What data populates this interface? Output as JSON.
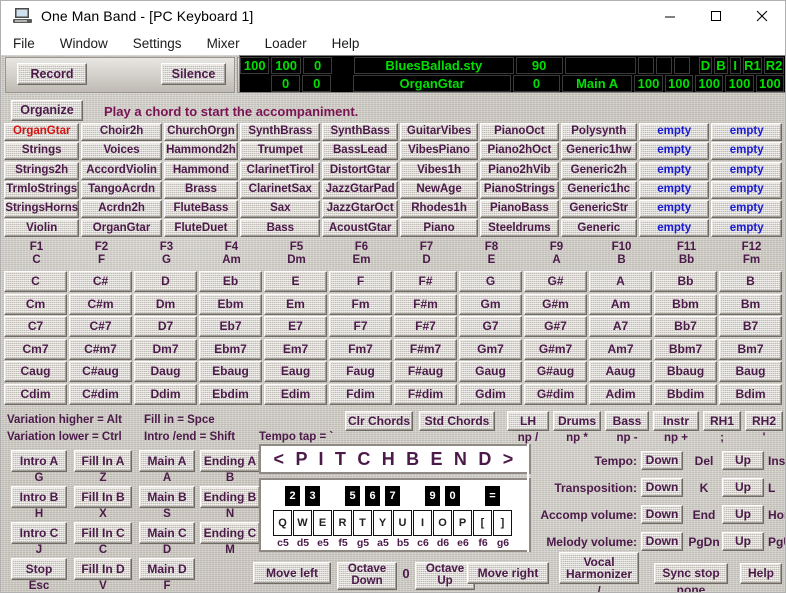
{
  "window": {
    "title": "One Man Band - [PC Keyboard 1]",
    "icon": "computer-icon",
    "minimize": "minimize-icon",
    "maximize": "maximize-icon",
    "close": "close-icon"
  },
  "menu": [
    "File",
    "Window",
    "Settings",
    "Mixer",
    "Loader",
    "Help"
  ],
  "toolbar": {
    "record": "Record",
    "silence": "Silence",
    "organize": "Organize",
    "status_message": "Play a chord to start the accompaniment."
  },
  "led": {
    "color": "#00e000",
    "row1": [
      "100",
      "100",
      "0",
      "",
      "BluesBallad.sty",
      "90",
      "",
      "",
      "",
      "",
      "",
      "D",
      "B",
      "I",
      "R1",
      "R2"
    ],
    "row2": [
      "",
      "0",
      "0",
      "",
      "OrganGtar",
      "0",
      "Main A",
      "100",
      "100",
      "100",
      "100",
      "100"
    ]
  },
  "instruments": {
    "selected": "OrganGtar",
    "rows": [
      [
        "OrganGtar",
        "Choir2h",
        "ChurchOrgn",
        "SynthBrass",
        "SynthBass",
        "GuitarVibes",
        "PianoOct",
        "Polysynth",
        "empty",
        "empty"
      ],
      [
        "Strings",
        "Voices",
        "Hammond2h",
        "Trumpet",
        "BassLead",
        "VibesPiano",
        "Piano2hOct",
        "Generic1hw",
        "empty",
        "empty"
      ],
      [
        "Strings2h",
        "AccordViolin",
        "Hammond",
        "ClarinetTirol",
        "DistortGtar",
        "Vibes1h",
        "Piano2hVib",
        "Generic2h",
        "empty",
        "empty"
      ],
      [
        "TrmloStrings",
        "TangoAcrdn",
        "Brass",
        "ClarinetSax",
        "JazzGtarPad",
        "NewAge",
        "PianoStrings",
        "Generic1hc",
        "empty",
        "empty"
      ],
      [
        "StringsHorns",
        "Acrdn2h",
        "FluteBass",
        "Sax",
        "JazzGtarOct",
        "Rhodes1h",
        "PianoBass",
        "GenericStr",
        "empty",
        "empty"
      ],
      [
        "Violin",
        "OrganGtar",
        "FluteDuet",
        "Bass",
        "AcoustGtar",
        "Piano",
        "Steeldrums",
        "Generic",
        "empty",
        "empty"
      ]
    ]
  },
  "fkeys": [
    {
      "fn": "F1",
      "chord": "C"
    },
    {
      "fn": "F2",
      "chord": "F"
    },
    {
      "fn": "F3",
      "chord": "G"
    },
    {
      "fn": "F4",
      "chord": "Am"
    },
    {
      "fn": "F5",
      "chord": "Dm"
    },
    {
      "fn": "F6",
      "chord": "Em"
    },
    {
      "fn": "F7",
      "chord": "D"
    },
    {
      "fn": "F8",
      "chord": "E"
    },
    {
      "fn": "F9",
      "chord": "A"
    },
    {
      "fn": "F10",
      "chord": "B"
    },
    {
      "fn": "F11",
      "chord": "Bb"
    },
    {
      "fn": "F12",
      "chord": "Fm"
    }
  ],
  "chords": {
    "rows": [
      [
        "C",
        "C#",
        "D",
        "Eb",
        "E",
        "F",
        "F#",
        "G",
        "G#",
        "A",
        "Bb",
        "B"
      ],
      [
        "Cm",
        "C#m",
        "Dm",
        "Ebm",
        "Em",
        "Fm",
        "F#m",
        "Gm",
        "G#m",
        "Am",
        "Bbm",
        "Bm"
      ],
      [
        "C7",
        "C#7",
        "D7",
        "Eb7",
        "E7",
        "F7",
        "F#7",
        "G7",
        "G#7",
        "A7",
        "Bb7",
        "B7"
      ],
      [
        "Cm7",
        "C#m7",
        "Dm7",
        "Ebm7",
        "Em7",
        "Fm7",
        "F#m7",
        "Gm7",
        "G#m7",
        "Am7",
        "Bbm7",
        "Bm7"
      ],
      [
        "Caug",
        "C#aug",
        "Daug",
        "Ebaug",
        "Eaug",
        "Faug",
        "F#aug",
        "Gaug",
        "G#aug",
        "Aaug",
        "Bbaug",
        "Baug"
      ],
      [
        "Cdim",
        "C#dim",
        "Ddim",
        "Ebdim",
        "Edim",
        "Fdim",
        "F#dim",
        "Gdim",
        "G#dim",
        "Adim",
        "Bbdim",
        "Bdim"
      ]
    ]
  },
  "hints": {
    "variation_higher": "Variation higher = Alt",
    "variation_lower": "Variation lower = Ctrl",
    "fill_in": "Fill in = Spce",
    "intro_end": "Intro /end = Shift",
    "tempo_tap": "Tempo tap = `"
  },
  "chord_tools": {
    "clr_chords": "Clr Chords",
    "std_chords": "Std Chords"
  },
  "parts": [
    {
      "label": "LH",
      "key": "np /"
    },
    {
      "label": "Drums",
      "key": "np *"
    },
    {
      "label": "Bass",
      "key": "np -"
    },
    {
      "label": "Instr",
      "key": "np +"
    },
    {
      "label": "RH1",
      "key": ";"
    },
    {
      "label": "RH2",
      "key": "'"
    }
  ],
  "transport": {
    "rows": [
      [
        {
          "label": "Intro A",
          "key": "G"
        },
        {
          "label": "Fill In A",
          "key": "Z"
        },
        {
          "label": "Main A",
          "key": "A"
        },
        {
          "label": "Ending A",
          "key": "B"
        }
      ],
      [
        {
          "label": "Intro B",
          "key": "H"
        },
        {
          "label": "Fill In B",
          "key": "X"
        },
        {
          "label": "Main B",
          "key": "S"
        },
        {
          "label": "Ending B",
          "key": "N"
        }
      ],
      [
        {
          "label": "Intro C",
          "key": "J"
        },
        {
          "label": "Fill In C",
          "key": "C"
        },
        {
          "label": "Main C",
          "key": "D"
        },
        {
          "label": "Ending C",
          "key": "M"
        }
      ],
      [
        {
          "label": "Stop",
          "key": "Esc"
        },
        {
          "label": "Fill In D",
          "key": "V"
        },
        {
          "label": "Main D",
          "key": "F"
        },
        {
          "label": "",
          "key": ""
        }
      ]
    ]
  },
  "pitchbend": {
    "title": "< P I T C H B E N D >",
    "black_keys": [
      "2",
      "3",
      "5",
      "6",
      "7",
      "9",
      "0",
      "="
    ],
    "white_keys": [
      "Q",
      "W",
      "E",
      "R",
      "T",
      "Y",
      "U",
      "I",
      "O",
      "P",
      "[",
      "]"
    ],
    "note_labels": [
      "c5",
      "d5",
      "e5",
      "f5",
      "g5",
      "a5",
      "b5",
      "c6",
      "d6",
      "e6",
      "f6",
      "g6"
    ]
  },
  "bottom_bar": {
    "move_left": "Move left",
    "octave_down": "Octave Down",
    "octave_value": "0",
    "octave_up": "Octave Up",
    "move_right": "Move right",
    "vocal_harmonizer": "Vocal Harmonizer",
    "vocal_key": "/",
    "sync_stop": "Sync stop",
    "sync_stop_value": "none",
    "help": "Help"
  },
  "right_controls": [
    {
      "label": "Tempo:",
      "down": "Down",
      "down_key": "Del",
      "up": "Up",
      "up_key": "Ins"
    },
    {
      "label": "Transposition:",
      "down": "Down",
      "down_key": "K",
      "up": "Up",
      "up_key": "L"
    },
    {
      "label": "Accomp volume:",
      "down": "Down",
      "down_key": "End",
      "up": "Up",
      "up_key": "Home"
    },
    {
      "label": "Melody volume:",
      "down": "Down",
      "down_key": "PgDn",
      "up": "Up",
      "up_key": "PgUp"
    }
  ]
}
